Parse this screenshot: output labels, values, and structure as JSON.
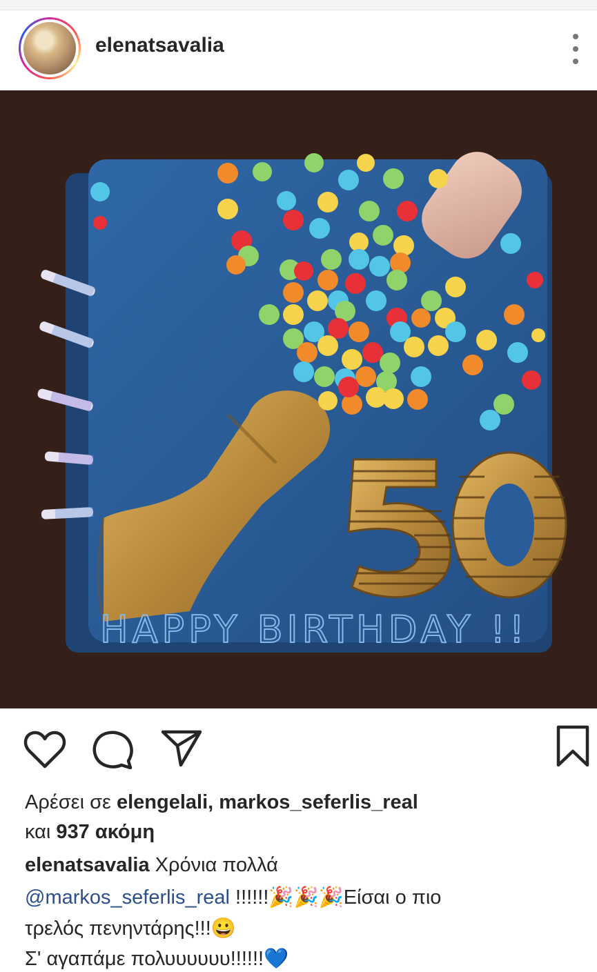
{
  "post": {
    "username": "elenatsavalia",
    "avatar_icon": "profile-avatar",
    "menu_icon": "more-vertical-icon"
  },
  "photo": {
    "cake_text": "HAPPY BIRTHDAY !!",
    "cake_number": "50"
  },
  "actions": {
    "like_icon": "heart-icon",
    "comment_icon": "comment-icon",
    "share_icon": "send-icon",
    "save_icon": "bookmark-icon"
  },
  "likes": {
    "prefix": "Αρέσει σε ",
    "users": "elengelali, markos_seferlis_real",
    "and": "και ",
    "count_text": "937 ακόμη"
  },
  "caption": {
    "username": "elenatsavalia",
    "line1_text": " Χρόνια πολλά",
    "mention": "@markos_seferlis_real",
    "line2_text": " !!!!!!🎉🎉🎉Είσαι ο πιο",
    "line3_text": "τρελός πενηντάρης!!!😀",
    "line4_text": "Σ' αγαπάμε πολυυυυυυ!!!!!!💙"
  },
  "colors": {
    "mention": "#2a4f8c",
    "cake": "#2a5c9a",
    "gold": "#b98a3c"
  }
}
